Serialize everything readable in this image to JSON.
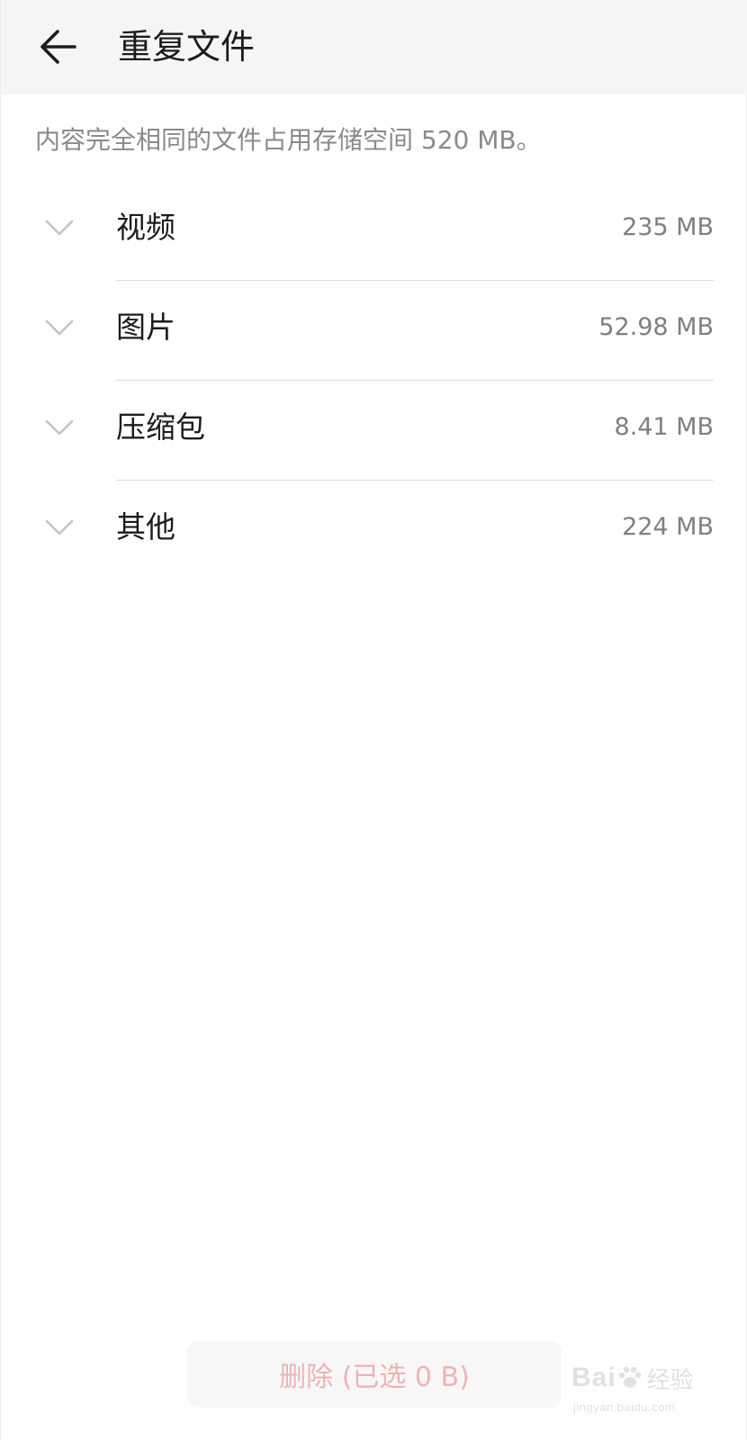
{
  "header": {
    "back_icon": "arrow-left-icon",
    "title": "重复文件"
  },
  "summary": "内容完全相同的文件占用存储空间 520 MB。",
  "categories": [
    {
      "label": "视频",
      "size": "235 MB",
      "icon": "chevron-down-icon"
    },
    {
      "label": "图片",
      "size": "52.98 MB",
      "icon": "chevron-down-icon"
    },
    {
      "label": "压缩包",
      "size": "8.41 MB",
      "icon": "chevron-down-icon"
    },
    {
      "label": "其他",
      "size": "224 MB",
      "icon": "chevron-down-icon"
    }
  ],
  "footer": {
    "delete_label": "删除 (已选 0 B)"
  },
  "watermark": {
    "brand": "Bai",
    "brand_cn": "经验",
    "url": "jingyan.baidu.com"
  },
  "colors": {
    "header_bg": "#f5f5f5",
    "delete_text": "#efb3b3"
  }
}
